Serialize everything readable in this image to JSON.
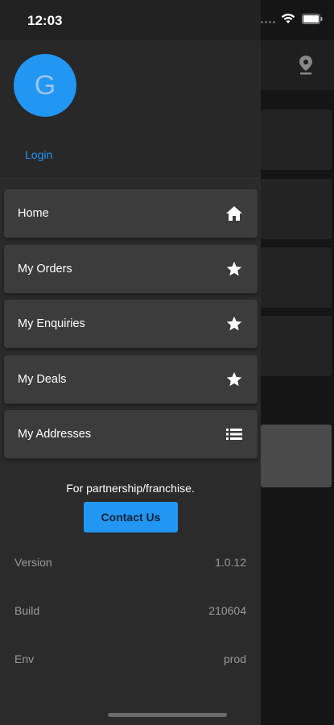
{
  "status": {
    "time": "12:03"
  },
  "profile": {
    "avatar_letter": "G",
    "login_label": "Login"
  },
  "menu": [
    {
      "label": "Home",
      "icon": "home-icon"
    },
    {
      "label": "My Orders",
      "icon": "star-icon"
    },
    {
      "label": "My Enquiries",
      "icon": "star-icon"
    },
    {
      "label": "My Deals",
      "icon": "star-icon"
    },
    {
      "label": "My Addresses",
      "icon": "list-icon"
    }
  ],
  "partnership": {
    "text": "For partnership/franchise.",
    "button": "Contact Us"
  },
  "info": [
    {
      "label": "Version",
      "value": "1.0.12"
    },
    {
      "label": "Build",
      "value": "210604"
    },
    {
      "label": "Env",
      "value": "prod"
    }
  ],
  "colors": {
    "accent": "#2196f3",
    "drawer_bg": "#2b2b2b",
    "menu_item_bg": "#3c3c3c"
  }
}
